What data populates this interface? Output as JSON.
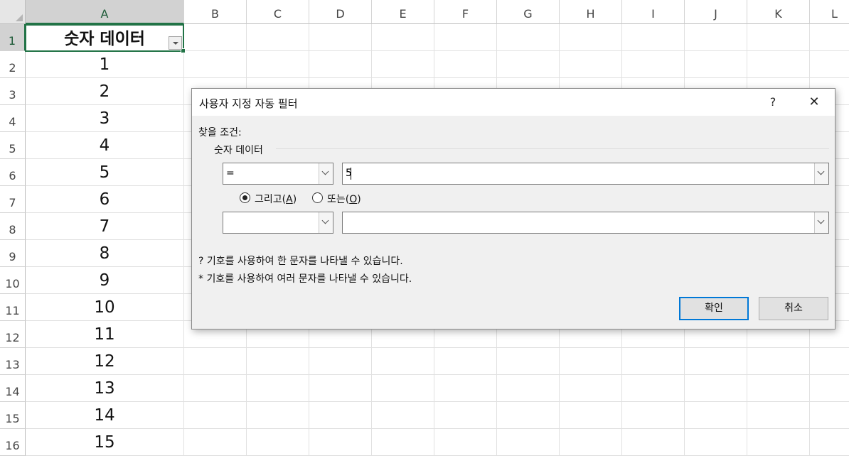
{
  "sheet": {
    "columns": [
      "A",
      "B",
      "C",
      "D",
      "E",
      "F",
      "G",
      "H",
      "I",
      "J",
      "K",
      "L"
    ],
    "rows": [
      "1",
      "2",
      "3",
      "4",
      "5",
      "6",
      "7",
      "8",
      "9",
      "10",
      "11",
      "12",
      "13",
      "14",
      "15",
      "16"
    ],
    "header_cell": "숫자 데이터",
    "values": [
      "1",
      "2",
      "3",
      "4",
      "5",
      "6",
      "7",
      "8",
      "9",
      "10",
      "11",
      "12",
      "13",
      "14",
      "15"
    ]
  },
  "dialog": {
    "title": "사용자 지정 자동 필터",
    "help": "?",
    "close": "✕",
    "find_label": "찾을 조건:",
    "field_name": "숫자 데이터",
    "op1": "=",
    "value1": "5",
    "op2": "",
    "value2": "",
    "and_label": "그리고",
    "and_key": "A",
    "or_label": "또는",
    "or_key": "O",
    "and_selected": true,
    "hint1": "? 기호를 사용하여 한 문자를 나타낼 수 있습니다.",
    "hint2": "* 기호를 사용하여 여러 문자를 나타낼 수 있습니다.",
    "ok": "확인",
    "cancel": "취소"
  }
}
